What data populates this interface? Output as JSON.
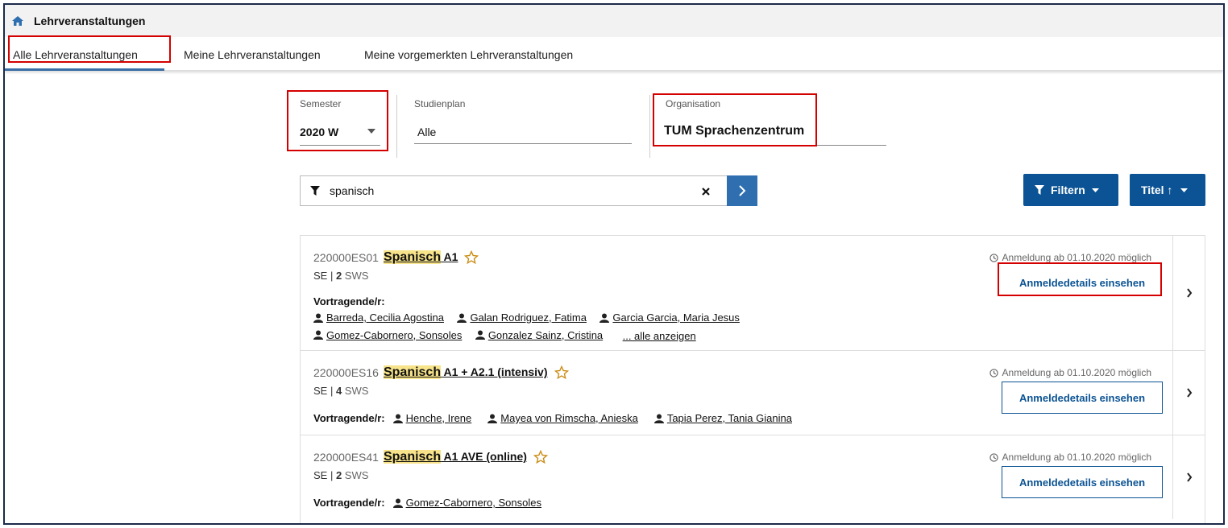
{
  "header": {
    "title": "Lehrveranstaltungen",
    "home_icon": "home-icon"
  },
  "tabs": [
    {
      "label": "Alle Lehrveranstaltungen",
      "active": true
    },
    {
      "label": "Meine Lehrveranstaltungen",
      "active": false
    },
    {
      "label": "Meine vorgemerkten Lehrveranstaltungen",
      "active": false
    }
  ],
  "filters": {
    "semester": {
      "label": "Semester",
      "value": "2020 W"
    },
    "studienplan": {
      "label": "Studienplan",
      "value": "Alle"
    },
    "organisation": {
      "label": "Organisation",
      "value": "TUM Sprachenzentrum"
    }
  },
  "search": {
    "value": "spanisch",
    "clear_icon": "close-icon",
    "go_icon": "chevron-right-icon"
  },
  "toolbar": {
    "filter_label": "Filtern",
    "sort_label": "Titel ↑"
  },
  "courses": [
    {
      "code": "220000ES01",
      "title_highlight": "Spanisch",
      "title_rest": " A1",
      "type": "SE | ",
      "sws_num": "2",
      "sws_label": " SWS",
      "registration_note": "Anmeldung ab 01.10.2020 möglich",
      "button_label": "Anmeldedetails einsehen",
      "lecturers_label": "Vortragende/r:",
      "lecturers": [
        "Barreda, Cecilia Agostina",
        "Galan Rodriguez, Fatima",
        "Garcia Garcia, Maria Jesus",
        "Gomez-Cabornero, Sonsoles",
        "Gonzalez Sainz, Cristina"
      ],
      "show_all": "... alle anzeigen"
    },
    {
      "code": "220000ES16",
      "title_highlight": "Spanisch",
      "title_rest": " A1 + A2.1 (intensiv)",
      "type": "SE | ",
      "sws_num": "4",
      "sws_label": " SWS",
      "registration_note": "Anmeldung ab 01.10.2020 möglich",
      "button_label": "Anmeldedetails einsehen",
      "lecturers_label": "Vortragende/r:",
      "lecturers": [
        "Henche, Irene",
        "Mayea von Rimscha, Anieska",
        "Tapia Perez, Tania Gianina"
      ]
    },
    {
      "code": "220000ES41",
      "title_highlight": "Spanisch",
      "title_rest": " A1 AVE (online)",
      "type": "SE | ",
      "sws_num": "2",
      "sws_label": " SWS",
      "registration_note": "Anmeldung ab 01.10.2020 möglich",
      "button_label": "Anmeldedetails einsehen",
      "lecturers_label": "Vortragende/r:",
      "lecturers": [
        "Gomez-Cabornero, Sonsoles"
      ]
    }
  ],
  "colors": {
    "accent": "#0b5394",
    "highlight": "#f7e38a",
    "annotation": "#d40000"
  }
}
